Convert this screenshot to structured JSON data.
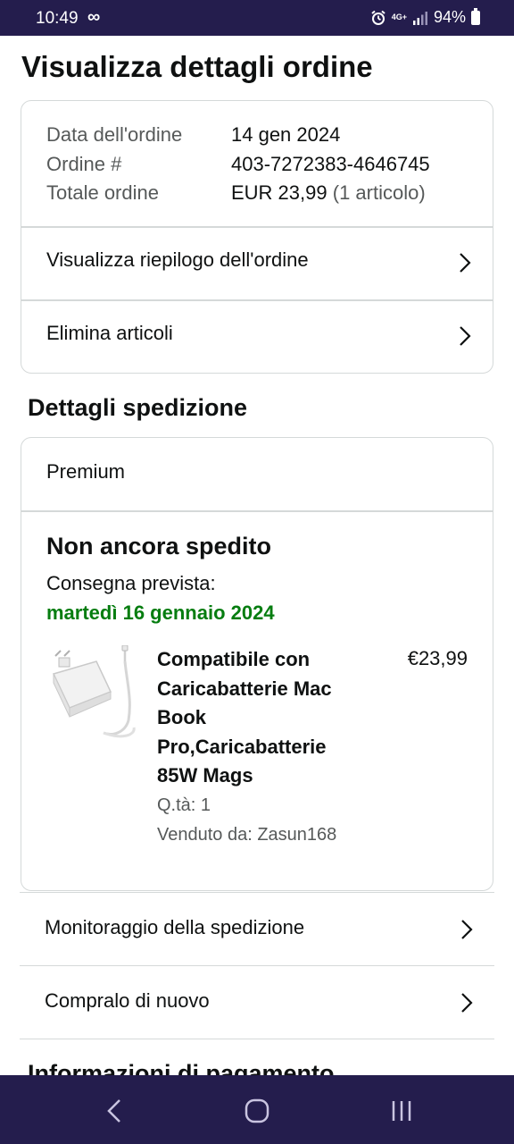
{
  "status_bar": {
    "time": "10:49",
    "infinity_symbol": "∞",
    "alarm_icon": "alarm-clock-icon",
    "network": "4G+",
    "battery": "94%"
  },
  "page": {
    "title": "Visualizza dettagli ordine"
  },
  "order_summary": {
    "rows": [
      {
        "label": "Data dell'ordine",
        "value": "14 gen 2024",
        "extra": ""
      },
      {
        "label": "Ordine #",
        "value": "403-7272383-4646745",
        "extra": ""
      },
      {
        "label": "Totale ordine",
        "value": "EUR 23,99",
        "extra": " (1 articolo)"
      }
    ],
    "links": [
      {
        "label": "Visualizza riepilogo dell'ordine"
      },
      {
        "label": "Elimina articoli"
      }
    ]
  },
  "shipping": {
    "section_title": "Dettagli spedizione",
    "tier": "Premium",
    "status": "Non ancora spedito",
    "eta_label": "Consegna prevista:",
    "eta_date": "martedì 16 gennaio 2024",
    "item": {
      "title": "Compatibile con Caricabatterie Mac Book Pro,Caricabatterie 85W Mags",
      "price": "€23,99",
      "qty": "Q.tà: 1",
      "seller": "Venduto da: Zasun168",
      "image_icon": "laptop-charger-image"
    },
    "actions": [
      {
        "label": "Monitoraggio della spedizione"
      },
      {
        "label": "Compralo di nuovo"
      }
    ]
  },
  "payment": {
    "section_title": "Informazioni di pagamento"
  },
  "colors": {
    "status_bar_bg": "#241d4d",
    "delivery_green": "#067d10",
    "muted_text": "#565959",
    "border": "#d5d9d9"
  }
}
